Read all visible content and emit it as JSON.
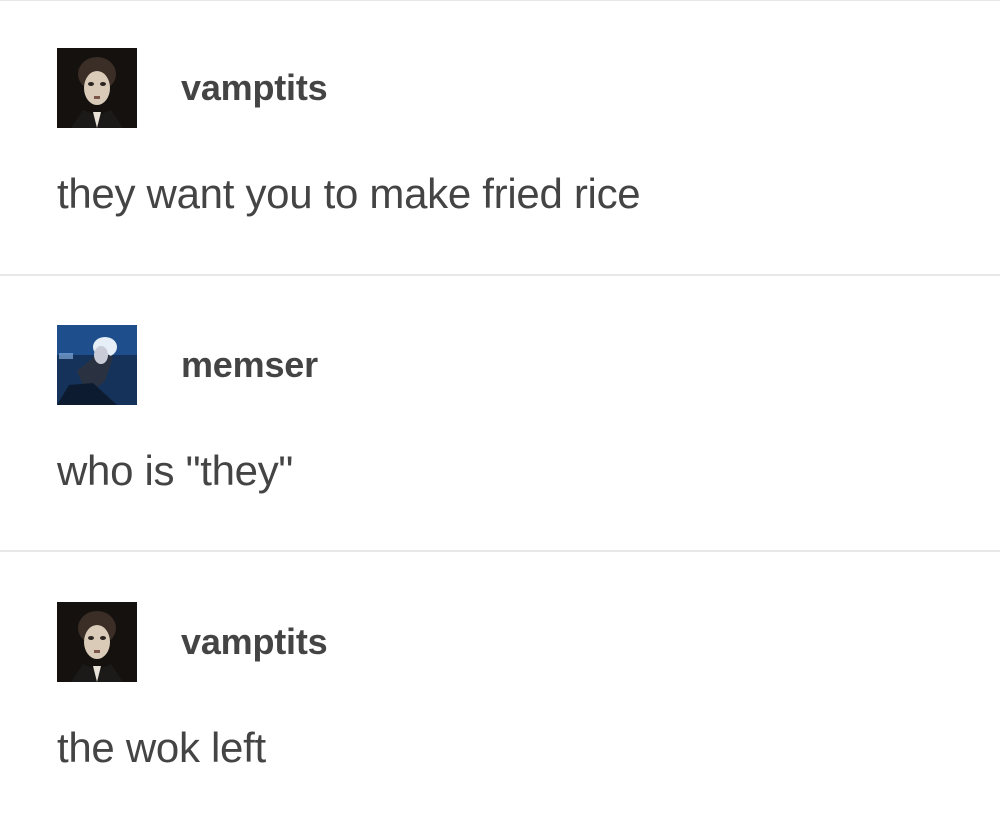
{
  "posts": [
    {
      "username": "vamptits",
      "avatar_icon": "dark-portrait-avatar-icon",
      "text": "they want you to make fried rice"
    },
    {
      "username": "memser",
      "avatar_icon": "blue-stage-avatar-icon",
      "text": "who is \"they\""
    },
    {
      "username": "vamptits",
      "avatar_icon": "dark-portrait-avatar-icon",
      "text": "the wok left"
    }
  ],
  "colors": {
    "text": "#444444",
    "divider": "#e8e8e8",
    "background": "#ffffff"
  }
}
